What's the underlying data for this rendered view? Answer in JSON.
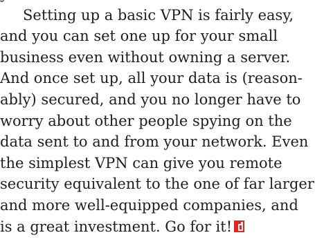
{
  "article": {
    "lines": [
      "y",
      "Setting up a basic VPN is fairly easy,",
      "and you can set one up for your small",
      "business even without owning a server.",
      "And once set up, all your data is (reason-",
      "ably) secured, and you no longer have to",
      "worry about other people spying on the",
      "data sent to and from your network. Even",
      "the simplest VPN can give you remote",
      "security equivalent to the one of far larger",
      "and more well-equipped companies, and",
      "is a great investment. Go for it!"
    ],
    "end_mark": {
      "icon": "end-of-article-mark-icon",
      "color": "#e2231a"
    }
  }
}
